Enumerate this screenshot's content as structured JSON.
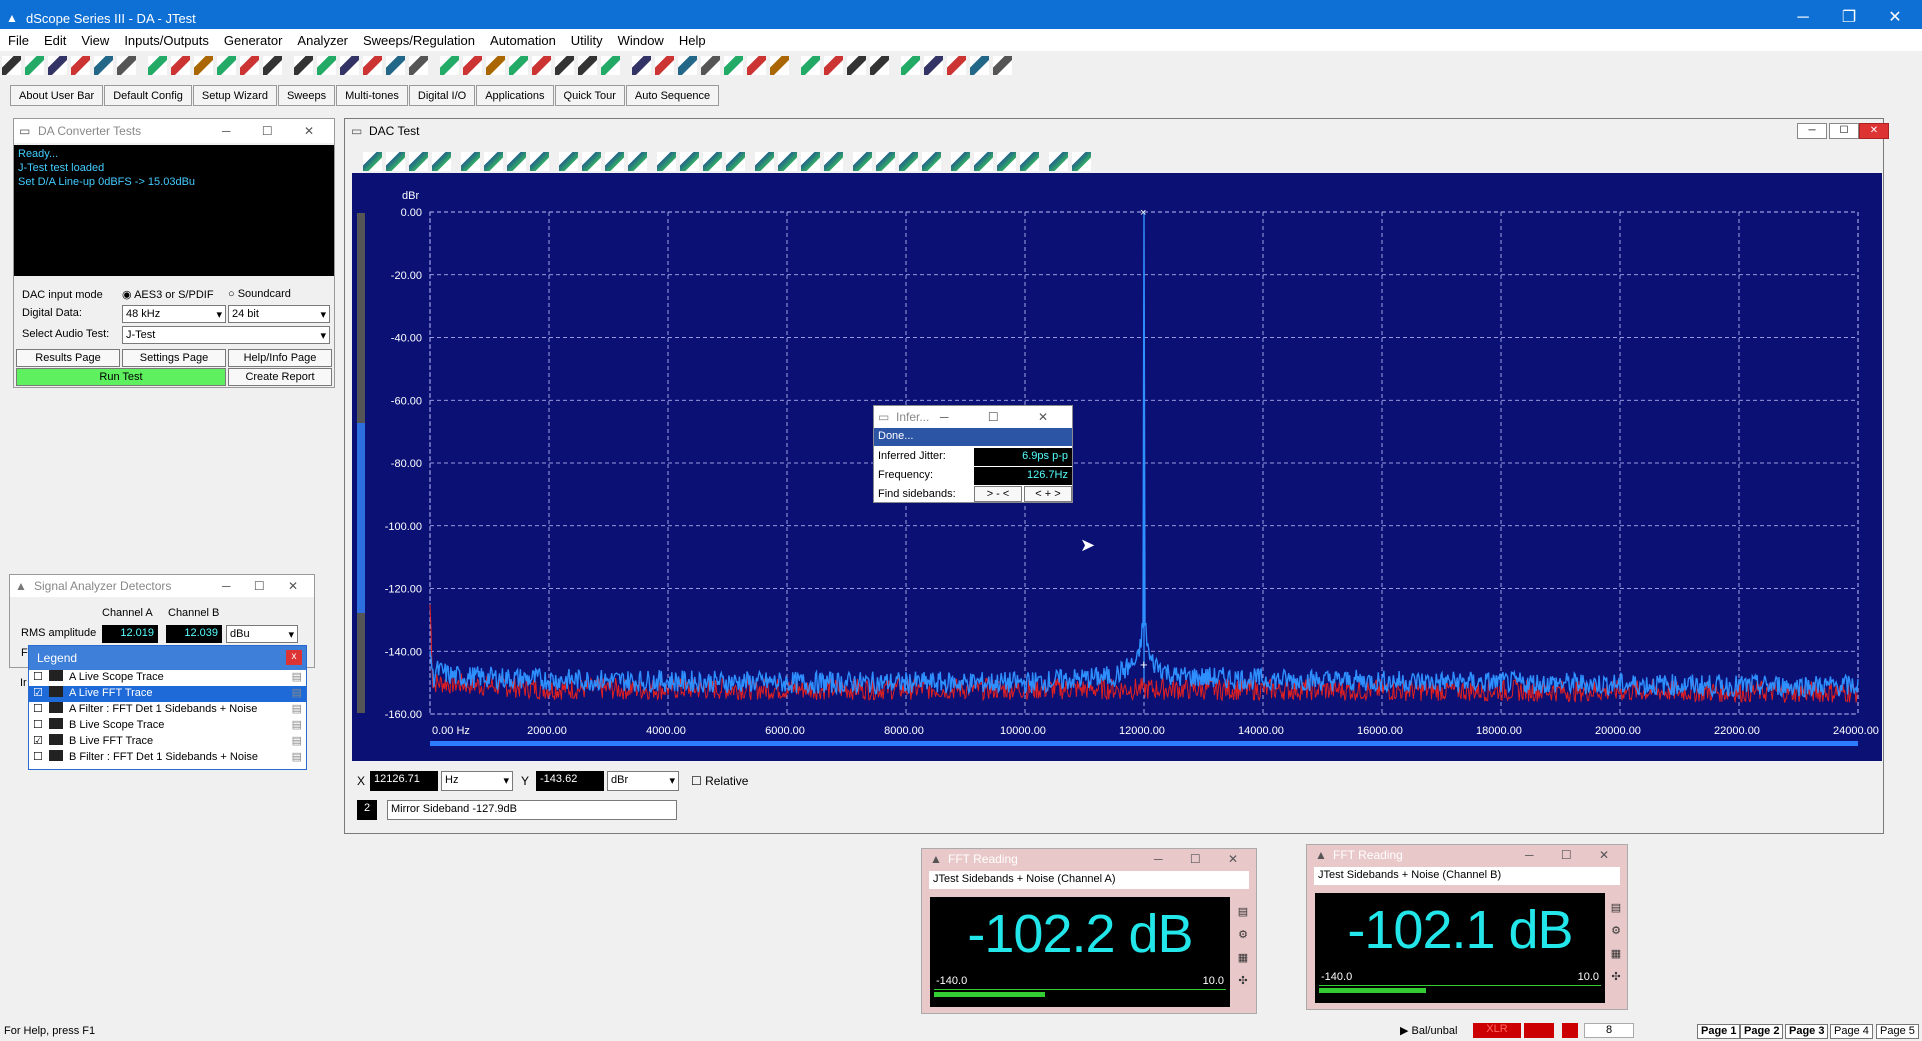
{
  "app": {
    "title": "dScope Series III - DA - JTest"
  },
  "menu": [
    "File",
    "Edit",
    "View",
    "Inputs/Outputs",
    "Generator",
    "Analyzer",
    "Sweeps/Regulation",
    "Automation",
    "Utility",
    "Window",
    "Help"
  ],
  "userbar": [
    "About User Bar",
    "Default Config",
    "Setup Wizard",
    "Sweeps",
    "Multi-tones",
    "Digital I/O",
    "Applications",
    "Quick Tour",
    "Auto Sequence"
  ],
  "da_tests": {
    "title": "DA Converter Tests",
    "console": [
      "Ready...",
      "J-Test test loaded",
      "Set D/A Line-up 0dBFS -> 15.03dBu"
    ],
    "input_mode_label": "DAC input mode",
    "opt1": "AES3 or S/PDIF",
    "opt2": "Soundcard",
    "digital_label": "Digital Data:",
    "rate": "48 kHz",
    "bits": "24 bit",
    "audio_test_label": "Select Audio Test:",
    "audio_test": "J-Test",
    "results": "Results Page",
    "settings": "Settings Page",
    "help": "Help/Info Page",
    "run": "Run Test",
    "report": "Create Report"
  },
  "detectors": {
    "title": "Signal Analyzer Detectors",
    "cha": "Channel A",
    "chb": "Channel B",
    "rms_label": "RMS amplitude",
    "rms_a": "12.019",
    "rms_b": "12.039",
    "unit": "dBu",
    "f_label": "F",
    "i_label": "Ir"
  },
  "legend": {
    "title": "Legend",
    "close": "x",
    "items": [
      {
        "label": "A  Live Scope Trace",
        "checked": false,
        "selected": false
      },
      {
        "label": "A  Live FFT Trace",
        "checked": true,
        "selected": true
      },
      {
        "label": "A  Filter : FFT Det 1 Sidebands + Noise",
        "checked": false,
        "selected": false
      },
      {
        "label": "B  Live Scope Trace",
        "checked": false,
        "selected": false
      },
      {
        "label": "B  Live FFT Trace",
        "checked": true,
        "selected": false
      },
      {
        "label": "B  Filter : FFT Det 1 Sidebands + Noise",
        "checked": false,
        "selected": false
      }
    ]
  },
  "dac_test": {
    "title": "DAC Test",
    "y_unit": "dBr",
    "cursor": {
      "x_label": "X",
      "x": "12126.71",
      "x_unit": "Hz",
      "y_label": "Y",
      "y": "-143.62",
      "y_unit": "dBr",
      "relative": "Relative"
    },
    "marker_num": "2",
    "marker_text": "Mirror Sideband -127.9dB"
  },
  "chart_data": {
    "type": "line",
    "title": "",
    "xlabel": "",
    "ylabel": "dBr",
    "xlim": [
      0,
      24000
    ],
    "ylim": [
      -160,
      0
    ],
    "x_ticks": [
      "0.00 Hz",
      "2000.00",
      "4000.00",
      "6000.00",
      "8000.00",
      "10000.00",
      "12000.00",
      "14000.00",
      "16000.00",
      "18000.00",
      "20000.00",
      "22000.00",
      "24000.00"
    ],
    "y_ticks": [
      "0.00",
      "-20.00",
      "-40.00",
      "-60.00",
      "-80.00",
      "-100.00",
      "-120.00",
      "-140.00",
      "-160.00"
    ],
    "series": [
      {
        "name": "A  Live FFT Trace",
        "color": "#2e8fff",
        "x": [
          0,
          50,
          100,
          400,
          2000,
          6000,
          10000,
          11500,
          11900,
          11990,
          12000,
          12010,
          12100,
          12500,
          14000,
          18000,
          22000,
          24000
        ],
        "y": [
          -138,
          -149,
          -146,
          -148,
          -149,
          -150,
          -150,
          -148,
          -143,
          -131,
          0,
          -131,
          -143,
          -148,
          -149,
          -150,
          -151,
          -151
        ]
      },
      {
        "name": "B  Live FFT Trace",
        "color": "#e02020",
        "x": [
          0,
          50,
          100,
          2000,
          12000,
          24000
        ],
        "y": [
          -125,
          -151,
          -150,
          -152,
          -152,
          -153
        ]
      }
    ]
  },
  "infer": {
    "title": "Infer...",
    "status": "Done...",
    "jitter_label": "Inferred Jitter:",
    "jitter": "6.9ps p-p",
    "freq_label": "Frequency:",
    "freq": "126.7Hz",
    "find_label": "Find sidebands:",
    "btn1": "> - <",
    "btn2": "< + >"
  },
  "fft_a": {
    "title": "FFT Reading",
    "sub": "JTest Sidebands + Noise  (Channel A)",
    "value": "-102.2 dB",
    "min": "-140.0",
    "max": "10.0",
    "level": 0.38
  },
  "fft_b": {
    "title": "FFT Reading",
    "sub": "JTest Sidebands + Noise (Channel B)",
    "value": "-102.1 dB",
    "min": "-140.0",
    "max": "10.0",
    "level": 0.38
  },
  "status": {
    "help": "For Help, press F1",
    "items": [
      "Bal/unbal",
      "XLR",
      "8"
    ],
    "pages": [
      "Page 1",
      "Page 2",
      "Page 3",
      "Page 4",
      "Page 5"
    ]
  }
}
